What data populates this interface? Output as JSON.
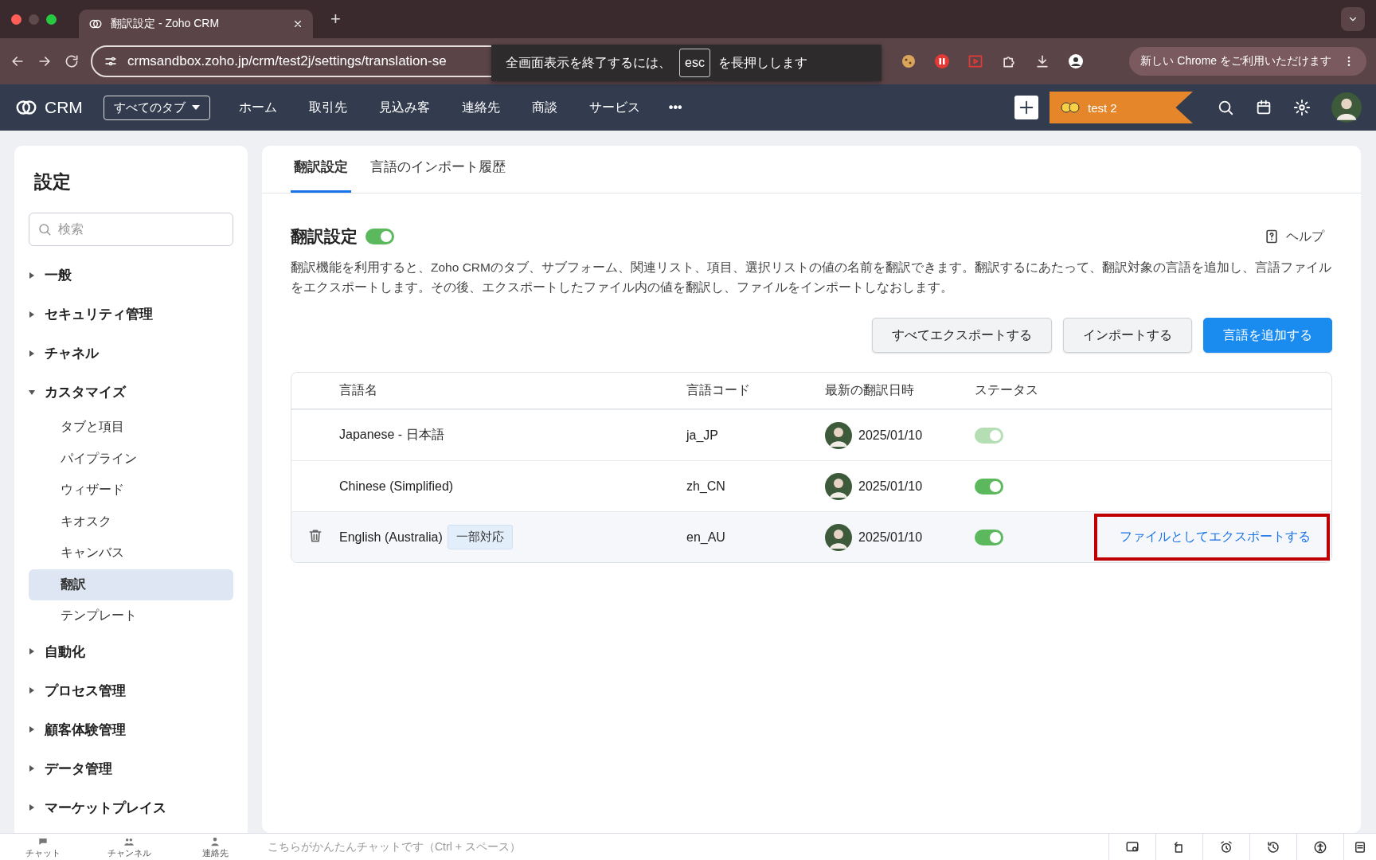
{
  "browser": {
    "tab_title": "翻訳設定 - Zoho CRM",
    "new_tab": "+",
    "url": "crmsandbox.zoho.jp/crm/test2j/settings/translation-se",
    "toast": {
      "before": "全画面表示を終了するには、",
      "key": "esc",
      "after": "を長押しします"
    },
    "update_button": "新しい Chrome をご利用いただけます"
  },
  "app_nav": {
    "logo": "CRM",
    "all_tabs": "すべてのタブ",
    "tabs": [
      {
        "label": "ホーム"
      },
      {
        "label": "取引先"
      },
      {
        "label": "見込み客"
      },
      {
        "label": "連絡先"
      },
      {
        "label": "商談"
      },
      {
        "label": "サービス"
      }
    ],
    "more": "•••",
    "org": "test 2"
  },
  "sidebar": {
    "title": "設定",
    "search_placeholder": "検索",
    "sections": [
      {
        "label": "一般",
        "expanded": false
      },
      {
        "label": "セキュリティ管理",
        "expanded": false
      },
      {
        "label": "チャネル",
        "expanded": false
      },
      {
        "label": "カスタマイズ",
        "expanded": true,
        "children": [
          {
            "label": "タブと項目",
            "selected": false
          },
          {
            "label": "パイプライン",
            "selected": false
          },
          {
            "label": "ウィザード",
            "selected": false
          },
          {
            "label": "キオスク",
            "selected": false
          },
          {
            "label": "キャンバス",
            "selected": false
          },
          {
            "label": "翻訳",
            "selected": true
          },
          {
            "label": "テンプレート",
            "selected": false
          }
        ]
      },
      {
        "label": "自動化",
        "expanded": false
      },
      {
        "label": "プロセス管理",
        "expanded": false
      },
      {
        "label": "顧客体験管理",
        "expanded": false
      },
      {
        "label": "データ管理",
        "expanded": false
      },
      {
        "label": "マーケットプレイス",
        "expanded": false
      }
    ]
  },
  "page": {
    "tabs": [
      {
        "label": "翻訳設定",
        "selected": true
      },
      {
        "label": "言語のインポート履歴",
        "selected": false
      }
    ],
    "heading": "翻訳設定",
    "enabled": true,
    "help": "ヘルプ",
    "description": "翻訳機能を利用すると、Zoho CRMのタブ、サブフォーム、関連リスト、項目、選択リストの値の名前を翻訳できます。翻訳するにあたって、翻訳対象の言語を追加し、言語ファイルをエクスポートします。その後、エクスポートしたファイル内の値を翻訳し、ファイルをインポートしなおします。",
    "buttons": [
      {
        "label": "すべてエクスポートする",
        "kind": "secondary"
      },
      {
        "label": "インポートする",
        "kind": "secondary"
      },
      {
        "label": "言語を追加する",
        "kind": "primary"
      }
    ],
    "table": {
      "columns": [
        "言語名",
        "言語コード",
        "最新の翻訳日時",
        "ステータス"
      ],
      "rows": [
        {
          "name": "Japanese - 日本語",
          "code": "ja_JP",
          "date": "2025/01/10",
          "on": true,
          "disabled": true,
          "hovered": false
        },
        {
          "name": "Chinese (Simplified)",
          "code": "zh_CN",
          "date": "2025/01/10",
          "on": true,
          "disabled": false,
          "hovered": false
        },
        {
          "name": "English (Australia)",
          "badge": "一部対応",
          "code": "en_AU",
          "date": "2025/01/10",
          "on": true,
          "disabled": false,
          "hovered": true,
          "action": "ファイルとしてエクスポートする",
          "highlighted": true
        }
      ]
    }
  },
  "bottom_bar": {
    "shortcuts": [
      "チャット",
      "チャンネル",
      "連絡先"
    ],
    "chat_placeholder": "こちらがかんたんチャットです（Ctrl + スペース）"
  }
}
